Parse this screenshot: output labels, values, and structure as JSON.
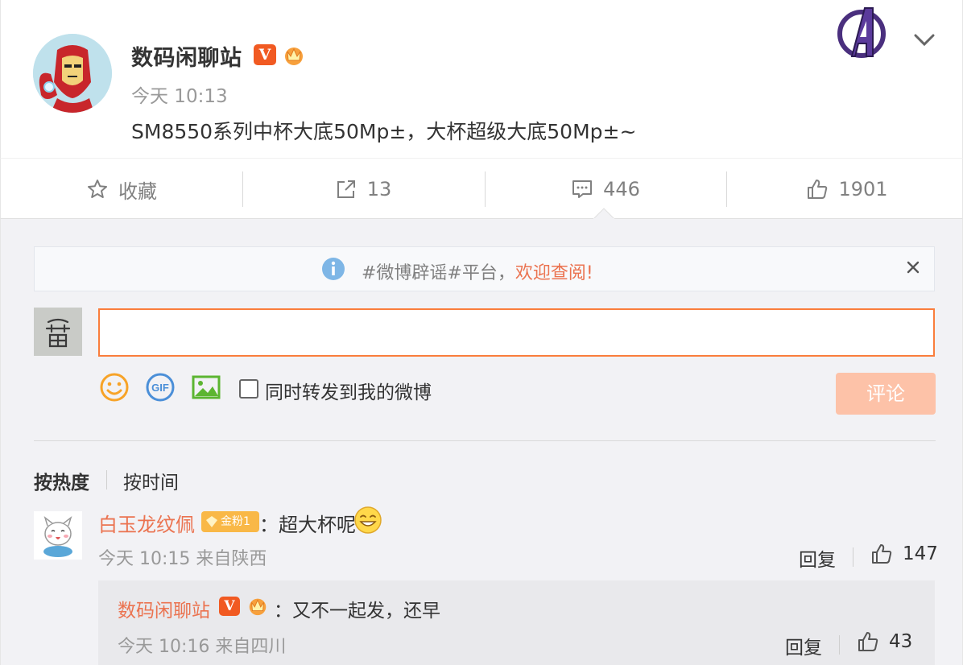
{
  "post": {
    "username": "数码闲聊站",
    "time": "今天 10:13",
    "text": "SM8550系列中杯大底50Mp±，大杯超级大底50Mp±~"
  },
  "actions": {
    "favorite_label": "收藏",
    "repost_count": "13",
    "comment_count": "446",
    "like_count": "1901"
  },
  "notice": {
    "prefix": "#微博辟谣#平台，",
    "link_text": "欢迎查阅!"
  },
  "composer": {
    "input_value": "",
    "repost_checkbox_label": "同时转发到我的微博",
    "submit_label": "评论"
  },
  "sort": {
    "hot_label": "按热度",
    "time_label": "按时间"
  },
  "comments": [
    {
      "username": "白玉龙纹佩",
      "badge": "金粉1",
      "text": "：超大杯呢",
      "meta": "今天 10:15 来自陕西",
      "reply_label": "回复",
      "like_count": "147",
      "replies": [
        {
          "username": "数码闲聊站",
          "text": "：又不一起发，还早",
          "meta": "今天 10:16 来自四川",
          "reply_label": "回复",
          "like_count": "43"
        }
      ]
    }
  ],
  "colors": {
    "accent_orange": "#eb7350",
    "input_border": "#fa7d3c",
    "submit_disabled": "#fdc2a8",
    "verified_badge": "#f15a22",
    "fan_badge": "#f9b847",
    "muted_text": "#999999",
    "comment_bg": "#f2f2f5"
  },
  "icons": [
    "avatar",
    "verified-v-icon",
    "crown-badge-icon",
    "avengers-logo-icon",
    "chevron-down-icon",
    "star-icon",
    "share-icon",
    "comment-icon",
    "thumbs-up-icon",
    "info-icon",
    "close-icon",
    "smiley-icon",
    "gif-icon",
    "image-icon",
    "gold-fan-badge-icon",
    "grin-emoji-icon"
  ]
}
